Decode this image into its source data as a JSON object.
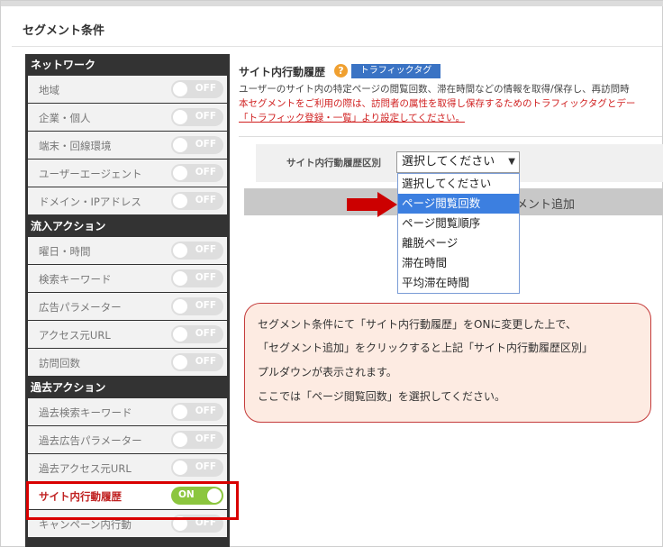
{
  "page": {
    "title": "セグメント条件"
  },
  "sidebar": {
    "sections": [
      {
        "header": "ネットワーク",
        "items": [
          {
            "label": "地域",
            "state": "OFF"
          },
          {
            "label": "企業・個人",
            "state": "OFF"
          },
          {
            "label": "端末・回線環境",
            "state": "OFF"
          },
          {
            "label": "ユーザーエージェント",
            "state": "OFF"
          },
          {
            "label": "ドメイン・IPアドレス",
            "state": "OFF"
          }
        ]
      },
      {
        "header": "流入アクション",
        "items": [
          {
            "label": "曜日・時間",
            "state": "OFF"
          },
          {
            "label": "検索キーワード",
            "state": "OFF"
          },
          {
            "label": "広告パラメーター",
            "state": "OFF"
          },
          {
            "label": "アクセス元URL",
            "state": "OFF"
          },
          {
            "label": "訪問回数",
            "state": "OFF"
          }
        ]
      },
      {
        "header": "過去アクション",
        "items": [
          {
            "label": "過去検索キーワード",
            "state": "OFF"
          },
          {
            "label": "過去広告パラメーター",
            "state": "OFF"
          },
          {
            "label": "過去アクセス元URL",
            "state": "OFF"
          },
          {
            "label": "サイト内行動履歴",
            "state": "ON",
            "active": true
          },
          {
            "label": "キャンペーン内行動",
            "state": "OFF"
          }
        ]
      }
    ]
  },
  "content": {
    "title": "サイト内行動履歴",
    "help_icon": "?",
    "tag_label": "トラフィックタグ",
    "desc_1": "ユーザーのサイト内の特定ページの閲覧回数、滞在時間などの情報を取得/保存し、再訪問時",
    "desc_2": "本セグメントをご利用の際は、訪問者の属性を取得し保存するためのトラフィックタグとデー",
    "desc_3": "「トラフィック登録・一覧」より設定してください。",
    "select_label": "サイト内行動履歴区別",
    "select_value": "選択してください",
    "add_button": "メント追加",
    "dropdown_options": [
      {
        "label": "選択してください",
        "selected": false
      },
      {
        "label": "ページ閲覧回数",
        "selected": true
      },
      {
        "label": "ページ閲覧順序",
        "selected": false
      },
      {
        "label": "離脱ページ",
        "selected": false
      },
      {
        "label": "滞在時間",
        "selected": false
      },
      {
        "label": "平均滞在時間",
        "selected": false
      }
    ]
  },
  "note": {
    "lines": [
      "セグメント条件にて「サイト内行動履歴」をONに変更した上で、",
      "「セグメント追加」をクリックすると上記「サイト内行動履歴区別」",
      "プルダウンが表示されます。",
      "ここでは「ページ閲覧回数」を選択してください。"
    ]
  },
  "colors": {
    "sidebar_bg": "#333333",
    "toggle_on": "#8cc63f",
    "toggle_off": "#dedede",
    "highlight": "#d90000",
    "tag_badge": "#3a73c4",
    "dropdown_selected": "#3c7fe0",
    "note_bg": "#fdebe2",
    "note_border": "#c43b3b"
  }
}
